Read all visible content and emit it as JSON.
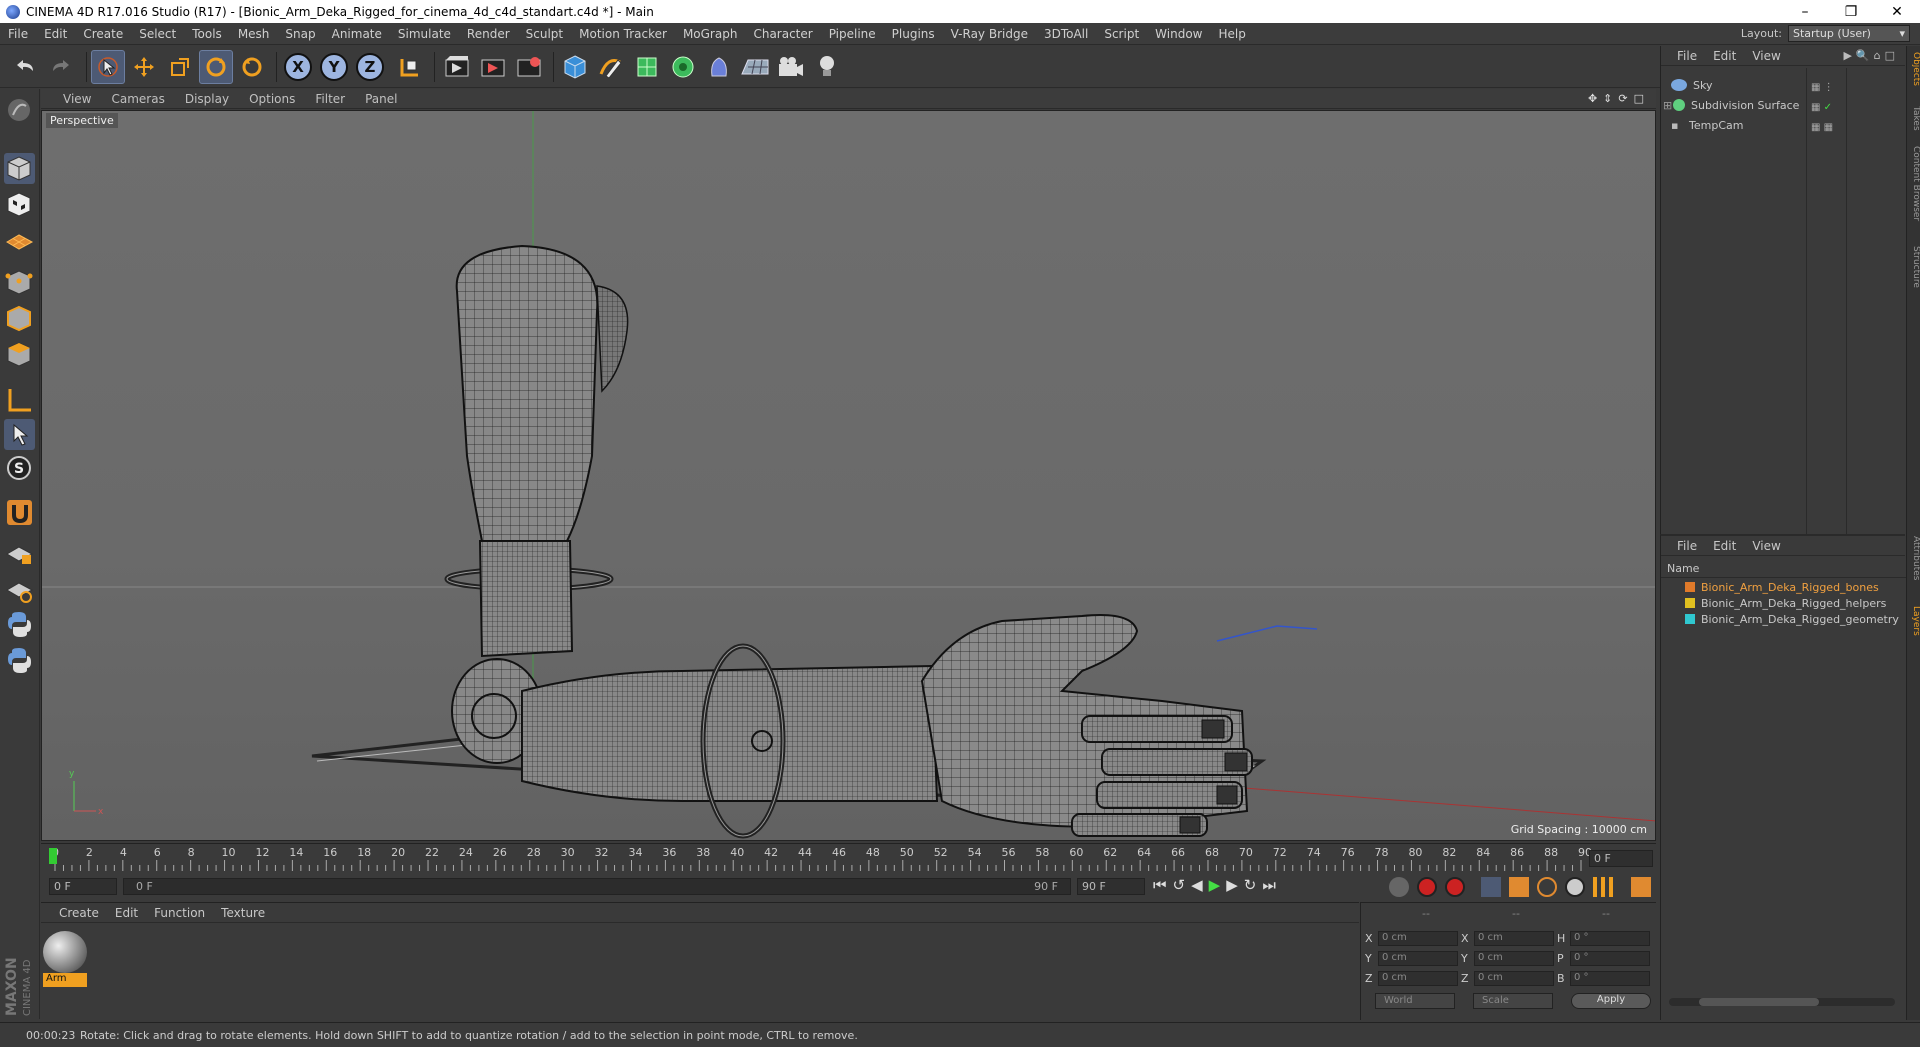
{
  "window": {
    "title": "CINEMA 4D R17.016 Studio (R17) - [Bionic_Arm_Deka_Rigged_for_cinema_4d_c4d_standart.c4d *] - Main"
  },
  "menubar": {
    "items": [
      "File",
      "Edit",
      "Create",
      "Select",
      "Tools",
      "Mesh",
      "Snap",
      "Animate",
      "Simulate",
      "Render",
      "Sculpt",
      "Motion Tracker",
      "MoGraph",
      "Character",
      "Pipeline",
      "Plugins",
      "V-Ray Bridge",
      "3DToAll",
      "Script",
      "Window",
      "Help"
    ],
    "layout_label": "Layout:",
    "layout_value": "Startup (User)"
  },
  "toolbar": {
    "axis_x": "X",
    "axis_y": "Y",
    "axis_z": "Z"
  },
  "viewport": {
    "menu": [
      "View",
      "Cameras",
      "Display",
      "Options",
      "Filter",
      "Panel"
    ],
    "label": "Perspective",
    "grid_spacing": "Grid Spacing : 10000 cm"
  },
  "timeline": {
    "ticks": [
      "0",
      "2",
      "4",
      "6",
      "8",
      "10",
      "12",
      "14",
      "16",
      "18",
      "20",
      "22",
      "24",
      "26",
      "28",
      "30",
      "32",
      "34",
      "36",
      "38",
      "40",
      "42",
      "44",
      "46",
      "48",
      "50",
      "52",
      "54",
      "56",
      "58",
      "60",
      "62",
      "64",
      "66",
      "68",
      "70",
      "72",
      "74",
      "76",
      "78",
      "80",
      "82",
      "84",
      "86",
      "88",
      "90"
    ],
    "current_frame": "0 F"
  },
  "transport": {
    "start_field": "0 F",
    "range_left": "0 F",
    "range_right": "90 F",
    "end_field": "90 F"
  },
  "materials": {
    "menu": [
      "Create",
      "Edit",
      "Function",
      "Texture"
    ],
    "items": [
      {
        "name": "Arm"
      }
    ]
  },
  "coordinates": {
    "headers": [
      "--",
      "--",
      "--"
    ],
    "rows": [
      {
        "a": "X",
        "av": "0 cm",
        "b": "X",
        "bv": "0 cm",
        "c": "H",
        "cv": "0 °"
      },
      {
        "a": "Y",
        "av": "0 cm",
        "b": "Y",
        "bv": "0 cm",
        "c": "P",
        "cv": "0 °"
      },
      {
        "a": "Z",
        "av": "0 cm",
        "b": "Z",
        "bv": "0 cm",
        "c": "B",
        "cv": "0 °"
      }
    ],
    "mode1": "World",
    "mode2": "Scale",
    "apply": "Apply"
  },
  "objects": {
    "menu": [
      "File",
      "Edit",
      "View"
    ],
    "items": [
      {
        "name": "Sky",
        "color": "#7aa8e0"
      },
      {
        "name": "Subdivision Surface",
        "color": "#5fcf7f"
      },
      {
        "name": "TempCam",
        "color": "#aaaaaa"
      }
    ]
  },
  "layers": {
    "menu": [
      "File",
      "Edit",
      "View"
    ],
    "header": "Name",
    "items": [
      {
        "name": "Bionic_Arm_Deka_Rigged_bones",
        "color": "#e07a2a",
        "text_color": "#f0a040"
      },
      {
        "name": "Bionic_Arm_Deka_Rigged_helpers",
        "color": "#e0c020",
        "text_color": "#c8c8c8"
      },
      {
        "name": "Bionic_Arm_Deka_Rigged_geometry",
        "color": "#30c8d0",
        "text_color": "#c8c8c8"
      }
    ]
  },
  "sidetabs": [
    "Objects",
    "Takes",
    "Content Browser",
    "Structure",
    "Attributes",
    "Layers"
  ],
  "status": {
    "time": "00:00:23",
    "message": "Rotate: Click and drag to rotate elements. Hold down SHIFT to add to quantize rotation / add to the selection in point mode, CTRL to remove."
  }
}
